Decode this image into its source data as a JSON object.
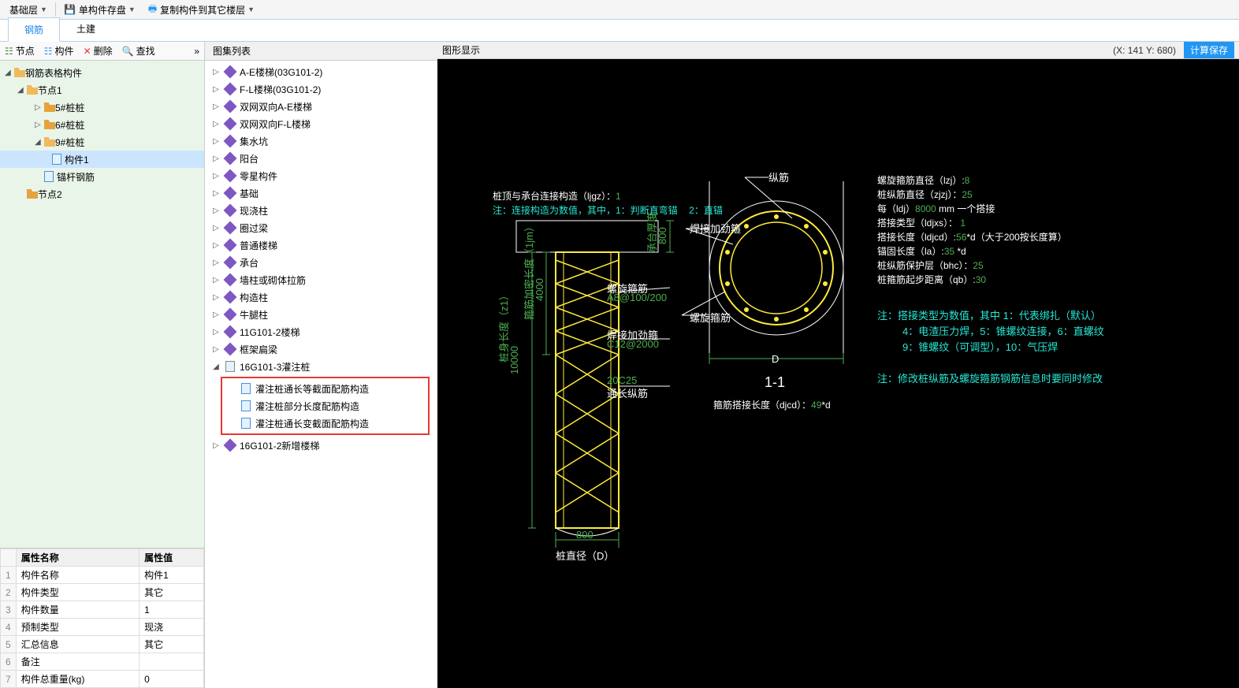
{
  "toolbar": {
    "basic_layer": "基础层",
    "single_save": "单构件存盘",
    "copy_component": "复制构件到其它楼层"
  },
  "tabs": {
    "rebar": "钢筋",
    "civil": "土建"
  },
  "left_toolbar": {
    "node": "节点",
    "component": "构件",
    "delete": "删除",
    "find": "查找"
  },
  "tree": {
    "root": "钢筋表格构件",
    "node1": "节点1",
    "pile5": "5#桩桩",
    "pile6": "6#桩桩",
    "pile9": "9#桩桩",
    "comp1": "构件1",
    "anchor": "锚杆钢筋",
    "node2": "节点2"
  },
  "props": {
    "header_name": "属性名称",
    "header_value": "属性值",
    "rows": [
      {
        "n": "1",
        "k": "构件名称",
        "v": "构件1"
      },
      {
        "n": "2",
        "k": "构件类型",
        "v": "其它"
      },
      {
        "n": "3",
        "k": "构件数量",
        "v": "1"
      },
      {
        "n": "4",
        "k": "预制类型",
        "v": "现浇"
      },
      {
        "n": "5",
        "k": "汇总信息",
        "v": "其它"
      },
      {
        "n": "6",
        "k": "备注",
        "v": ""
      },
      {
        "n": "7",
        "k": "构件总重量(kg)",
        "v": "0"
      }
    ]
  },
  "mid": {
    "title": "图集列表",
    "items": [
      "A-E楼梯(03G101-2)",
      "F-L楼梯(03G101-2)",
      "双网双向A-E楼梯",
      "双网双向F-L楼梯",
      "集水坑",
      "阳台",
      "零星构件",
      "基础",
      "现浇柱",
      "圈过梁",
      "普通楼梯",
      "承台",
      "墙柱或砌体拉筋",
      "构造柱",
      "牛腿柱",
      "11G101-2楼梯",
      "框架扁梁"
    ],
    "expanded": "16G101-3灌注桩",
    "sub_items": [
      "灌注桩通长等截面配筋构造",
      "灌注桩部分长度配筋构造",
      "灌注桩通长变截面配筋构造"
    ],
    "last": "16G101-2新增楼梯"
  },
  "right": {
    "title": "图形显示",
    "coords": "(X: 141 Y: 680)",
    "btn_save": "计算保存"
  },
  "cad": {
    "title_line": "桩顶与承台连接构造（ljgz）：",
    "title_val": "1",
    "note1a": "注：连接构造为数值，其中，1：判断直弯锚",
    "note1b": "2：直锚",
    "spiral": "螺旋箍筋",
    "spiral_spec": "A8@100/200",
    "weld": "焊接加劲箍",
    "weld_spec": "C12@2000",
    "long_rebar": "通长纵筋",
    "long_spec": "20C25",
    "pile_len": "桩身长度（z1）",
    "dense_len": "箍筋加密长度（1jm）",
    "cap_thick": "承台厚度",
    "dim800a": "800",
    "dim800b": "800",
    "dim10000": "10000",
    "dim4000": "4000",
    "pile_dia": "桩直径（D）",
    "sec_zong": "纵筋",
    "sec_weld": "焊接加劲箍",
    "sec_spiral": "螺旋箍筋",
    "sec_D": "D",
    "sec_title": "1-1",
    "overlap_label": "箍筋搭接长度（djcd）：",
    "overlap_val": "49",
    "overlap_suffix": "*d",
    "params": [
      {
        "k": "螺旋箍筋直径（lzj）:",
        "v": "8"
      },
      {
        "k": "桩纵筋直径（zjzj）：",
        "v": "25"
      },
      {
        "k": "每（ldj）",
        "v": "8000",
        "suffix": " mm 一个搭接",
        "suffix_color": "white"
      },
      {
        "k": "搭接类型（ldjxs）：",
        "v": " 1",
        "pre": "  "
      },
      {
        "k": "搭接长度（ldjcd）:",
        "v": "56",
        "suffix": "*d（大于200按长度算）"
      },
      {
        "k": "锚固长度（la）:",
        "v": "35",
        "suffix": " *d"
      },
      {
        "k": "桩纵筋保护层（bhc）：",
        "v": "25"
      },
      {
        "k": "桩箍筋起步距离（qb）:",
        "v": "30"
      }
    ],
    "note2a": "注：搭接类型为数值，其中 1：代表绑扎（默认）",
    "note2b": "4：电渣压力焊，5：锥螺纹连接，6：直螺纹",
    "note2c": "9：锥螺纹（可调型），10：气压焊",
    "note3": "注：修改桩纵筋及螺旋箍筋钢筋信息时要同时修改"
  }
}
